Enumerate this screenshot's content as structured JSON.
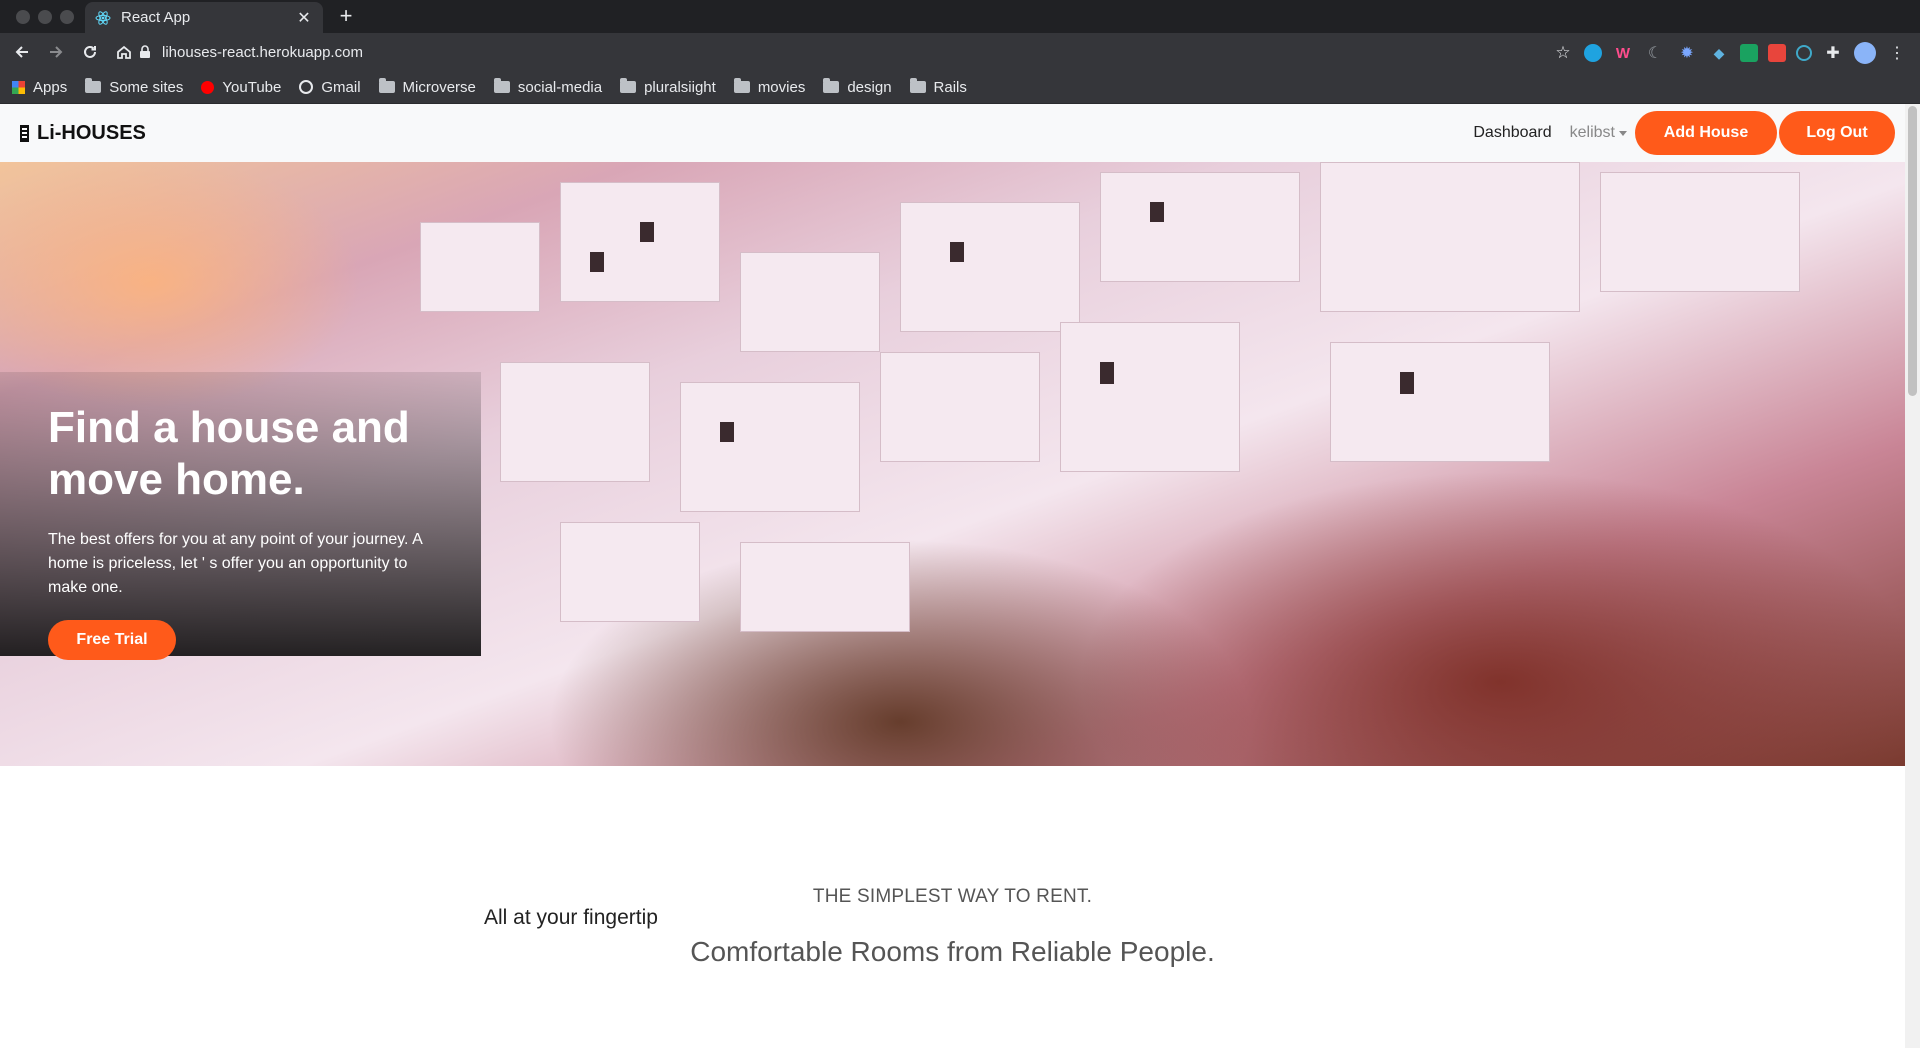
{
  "browser": {
    "tab_title": "React App",
    "url": "lihouses-react.herokuapp.com",
    "bookmarks": [
      "Apps",
      "Some sites",
      "YouTube",
      "Gmail",
      "Microverse",
      "social-media",
      "pluralsiight",
      "movies",
      "design",
      "Rails"
    ]
  },
  "navbar": {
    "brand": "Li-HOUSES",
    "dashboard": "Dashboard",
    "user": "kelibst",
    "add_house": "Add House",
    "logout": "Log Out"
  },
  "hero": {
    "title": "Find a house and move home.",
    "text": "The best offers for you at any point of your journey. A home is priceless, let ' s offer you an opportunity to make one.",
    "cta": "Free Trial"
  },
  "section": {
    "kicker": "THE SIMPLEST WAY TO RENT.",
    "title": "Comfortable Rooms from Reliable People.",
    "subtitle": "All at your fingertip"
  },
  "colors": {
    "accent": "#ff5a1a"
  }
}
